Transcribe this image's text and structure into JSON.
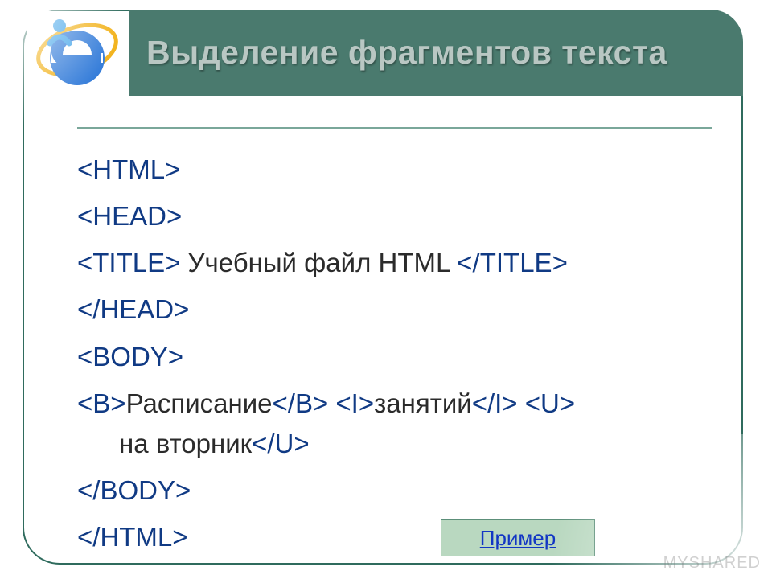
{
  "header": {
    "title": "Выделение фрагментов текста"
  },
  "code": {
    "l1_tag": "<HTML>",
    "l2_tag": "<HEAD>",
    "l3_open": "<TITLE>",
    "l3_text": " Учебный файл HTML ",
    "l3_close": "</TITLE>",
    "l4_tag": "</HEAD>",
    "l5_tag": "<BODY>",
    "l6_b_open": "<B>",
    "l6_b_text": "Расписание",
    "l6_b_close": "</B>",
    "l6_sp1": " ",
    "l6_i_open": "<I>",
    "l6_i_text": "занятий",
    "l6_i_close": "</I>",
    "l6_sp2": " ",
    "l6_u_open": "<U>",
    "l6_u_text": " на вторник",
    "l6_u_close": "</U>",
    "l7_tag": "</BODY>",
    "l8_tag": "</HTML>"
  },
  "link": {
    "label": "Пример"
  },
  "watermark": "MYSHARED"
}
